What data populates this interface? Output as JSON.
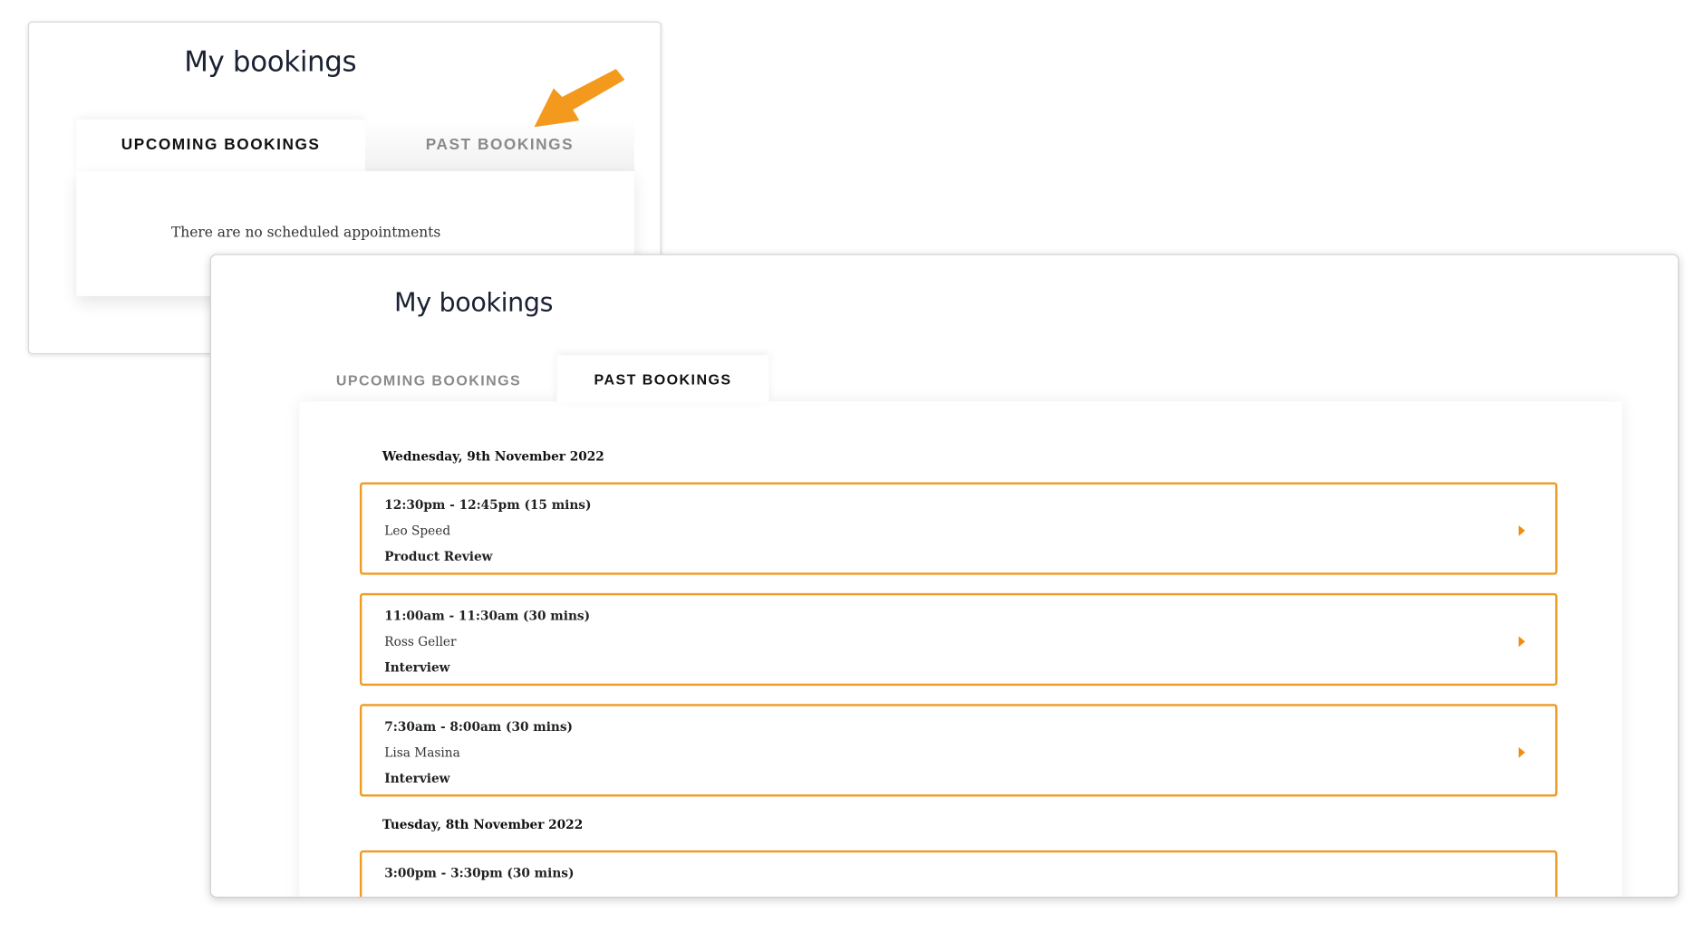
{
  "back_panel": {
    "title": "My bookings",
    "tabs": {
      "upcoming": "UPCOMING BOOKINGS",
      "past": "PAST BOOKINGS"
    },
    "empty_message": "There are no scheduled appointments"
  },
  "front_panel": {
    "title": "My bookings",
    "tabs": {
      "upcoming": "UPCOMING BOOKINGS",
      "past": "PAST BOOKINGS"
    },
    "groups": [
      {
        "date": "Wednesday, 9th November 2022",
        "bookings": [
          {
            "time": "12:30pm - 12:45pm (15 mins)",
            "name": "Leo Speed",
            "type": "Product Review"
          },
          {
            "time": "11:00am - 11:30am (30 mins)",
            "name": "Ross Geller",
            "type": "Interview"
          },
          {
            "time": "7:30am - 8:00am (30 mins)",
            "name": "Lisa Masina",
            "type": "Interview"
          }
        ]
      },
      {
        "date": "Tuesday, 8th November 2022",
        "bookings": [
          {
            "time": "3:00pm - 3:30pm (30 mins)",
            "name": "",
            "type": ""
          }
        ]
      }
    ]
  },
  "colors": {
    "accent": "#ef9a22",
    "arrow": "#f39a1e"
  }
}
